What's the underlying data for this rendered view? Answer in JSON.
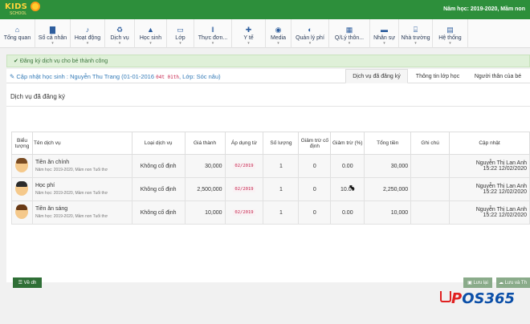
{
  "header": {
    "logo_text": "KIDS",
    "logo_sub": "SCHOOL",
    "school_year": "Năm học: 2019-2020, Mầm non"
  },
  "nav": [
    {
      "label": "Tổng quan",
      "icon": "home-icon",
      "glyph": "⌂",
      "caret": ""
    },
    {
      "label": "Sổ cá nhân",
      "icon": "book-icon",
      "glyph": "▇",
      "caret": "▾"
    },
    {
      "label": "Hoạt động",
      "icon": "activity-icon",
      "glyph": "♪",
      "caret": "▾"
    },
    {
      "label": "Dịch vụ",
      "icon": "recycle-icon",
      "glyph": "♻",
      "caret": "▾"
    },
    {
      "label": "Học sinh",
      "icon": "graduation-icon",
      "glyph": "▲",
      "caret": "▾"
    },
    {
      "label": "Lớp",
      "icon": "monitor-icon",
      "glyph": "▭",
      "caret": "▾"
    },
    {
      "label": "Thực đơn...",
      "icon": "cutlery-icon",
      "glyph": "ǁ",
      "caret": "▾"
    },
    {
      "label": "Y tế",
      "icon": "medkit-icon",
      "glyph": "✚",
      "caret": "▾"
    },
    {
      "label": "Media",
      "icon": "globe-icon",
      "glyph": "◉",
      "caret": "▾"
    },
    {
      "label": "Quản lý phí",
      "icon": "money-icon",
      "glyph": "◐",
      "caret": "▾"
    },
    {
      "label": "Q/Lý thôn...",
      "icon": "calculator-icon",
      "glyph": "▦",
      "caret": "▾"
    },
    {
      "label": "Nhân sự",
      "icon": "staff-icon",
      "glyph": "▬",
      "caret": "▾"
    },
    {
      "label": "Nhà trường",
      "icon": "school-icon",
      "glyph": "⌸",
      "caret": "▾"
    },
    {
      "label": "Hệ thống",
      "icon": "system-icon",
      "glyph": "▤",
      "caret": "▾"
    }
  ],
  "alert": {
    "text": "Đăng ký dịch vụ cho bé thành công"
  },
  "panel": {
    "title": "Cập nhật học sinh : Nguyễn Thu Trang (01-01-2016",
    "code": "04t 01th",
    "title_end": ", Lớp: Sóc nâu)",
    "tabs": [
      "Dịch vụ đã đăng ký",
      "Thông tin lớp học",
      "Người thân của bé"
    ]
  },
  "section": {
    "title": "Dịch vụ đã đăng ký"
  },
  "table": {
    "headers": [
      "Biểu tượng",
      "Tên dịch vụ",
      "Loại dịch vụ",
      "Giá thành",
      "Áp dụng từ",
      "Số lượng",
      "Giảm trừ cố định",
      "Giảm trừ (%)",
      "Tổng tiền",
      "Ghi chú",
      "Cập nhật"
    ],
    "rows": [
      {
        "name": "Tiền ăn chính",
        "sub": "Năm học: 2019-2020, Mầm non Tuổi thơ",
        "type": "Không cố định",
        "price": "30,000",
        "from": "02/2019",
        "qty": "1",
        "fixed": "0",
        "pct": "0.00",
        "total": "30,000",
        "note": "",
        "updated_by": "Nguyễn Thị Lan Anh",
        "updated_at": "15:22 12/02/2020"
      },
      {
        "name": "Học phí",
        "sub": "Năm học: 2019-2020, Mầm non Tuổi thơ",
        "type": "Không cố định",
        "price": "2,500,000",
        "from": "02/2019",
        "qty": "1",
        "fixed": "0",
        "pct": "10.00",
        "total": "2,250,000",
        "note": "",
        "updated_by": "Nguyễn Thị Lan Anh",
        "updated_at": "15:22 12/02/2020"
      },
      {
        "name": "Tiền ăn sáng",
        "sub": "Năm học: 2019-2020, Mầm non Tuổi thơ",
        "type": "Không cố định",
        "price": "10,000",
        "from": "02/2019",
        "qty": "1",
        "fixed": "0",
        "pct": "0.00",
        "total": "10,000",
        "note": "",
        "updated_by": "Nguyễn Thị Lan Anh",
        "updated_at": "15:22 12/02/2020"
      }
    ]
  },
  "buttons": {
    "back": "Về dh",
    "save": "Lưu lại",
    "save_next": "Lưu và Th"
  },
  "brand": {
    "text_a": "P",
    "text_b": "OS365"
  },
  "colors": {
    "topbar": "#2d8f3b",
    "accent": "#337ab7",
    "alert_bg": "#dff0d8",
    "period": "#c7254e"
  }
}
